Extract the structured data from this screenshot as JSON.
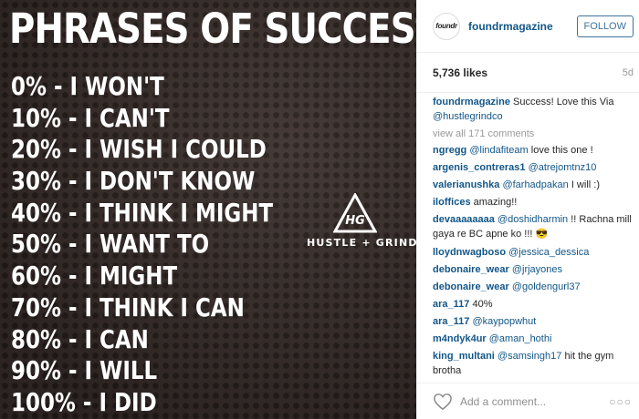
{
  "image": {
    "title": "PHRASES OF SUCCESS",
    "phrases": [
      "0% - I WON'T",
      "10% - I CAN'T",
      "20% - I WISH I COULD",
      "30% - I DON'T KNOW",
      "40% - I THINK I MIGHT",
      "50% - I WANT TO",
      "60% - I MIGHT",
      "70% - I THINK I CAN",
      "80% - I CAN",
      "90% - I WILL",
      "100% - I DID"
    ],
    "logo_monogram": "HG",
    "logo_text": "HUSTLE + GRIND"
  },
  "header": {
    "avatar_text": "foundr",
    "username": "foundrmagazine",
    "follow_label": "FOLLOW"
  },
  "stats": {
    "likes": "5,736 likes",
    "age": "5d"
  },
  "caption": {
    "user": "foundrmagazine",
    "text": " Success! Love this Via",
    "mention": "@hustlegrindco"
  },
  "view_all": "view all 171 comments",
  "comments": [
    {
      "user": "ngregg",
      "mention": "@lindafiteam",
      "text": " love this one !"
    },
    {
      "user": "argenis_contreras1",
      "mention": "@atrejomtnz10",
      "text": ""
    },
    {
      "user": "valerianushka",
      "mention": "@farhadpakan",
      "text": " I will :)"
    },
    {
      "user": "iloffices",
      "mention": "",
      "text": "amazing!!"
    },
    {
      "user": "devaaaaaaaa",
      "mention": "@doshidharmin",
      "text": " !! Rachna mill gaya re BC apne ko !!! 😎"
    },
    {
      "user": "lloydnwagboso",
      "mention": "@jessica_dessica",
      "text": ""
    },
    {
      "user": "debonaire_wear",
      "mention": "@jrjayones",
      "text": ""
    },
    {
      "user": "debonaire_wear",
      "mention": "@goldengurl37",
      "text": ""
    },
    {
      "user": "ara_117",
      "mention": "",
      "text": "40%"
    },
    {
      "user": "ara_117",
      "mention": "@kaypopwhut",
      "text": ""
    },
    {
      "user": "m4ndyk4ur",
      "mention": "@aman_hothi",
      "text": ""
    },
    {
      "user": "king_multani",
      "mention": "@samsingh17",
      "text": " hit the gym brotha"
    }
  ],
  "footer": {
    "add_comment_placeholder": "Add a comment...",
    "more_label": "○○○",
    "heart_icon": "heart-icon"
  },
  "colors": {
    "username_blue": "#125688",
    "follow_blue": "#3f729b",
    "image_bg": "#3b302d"
  }
}
